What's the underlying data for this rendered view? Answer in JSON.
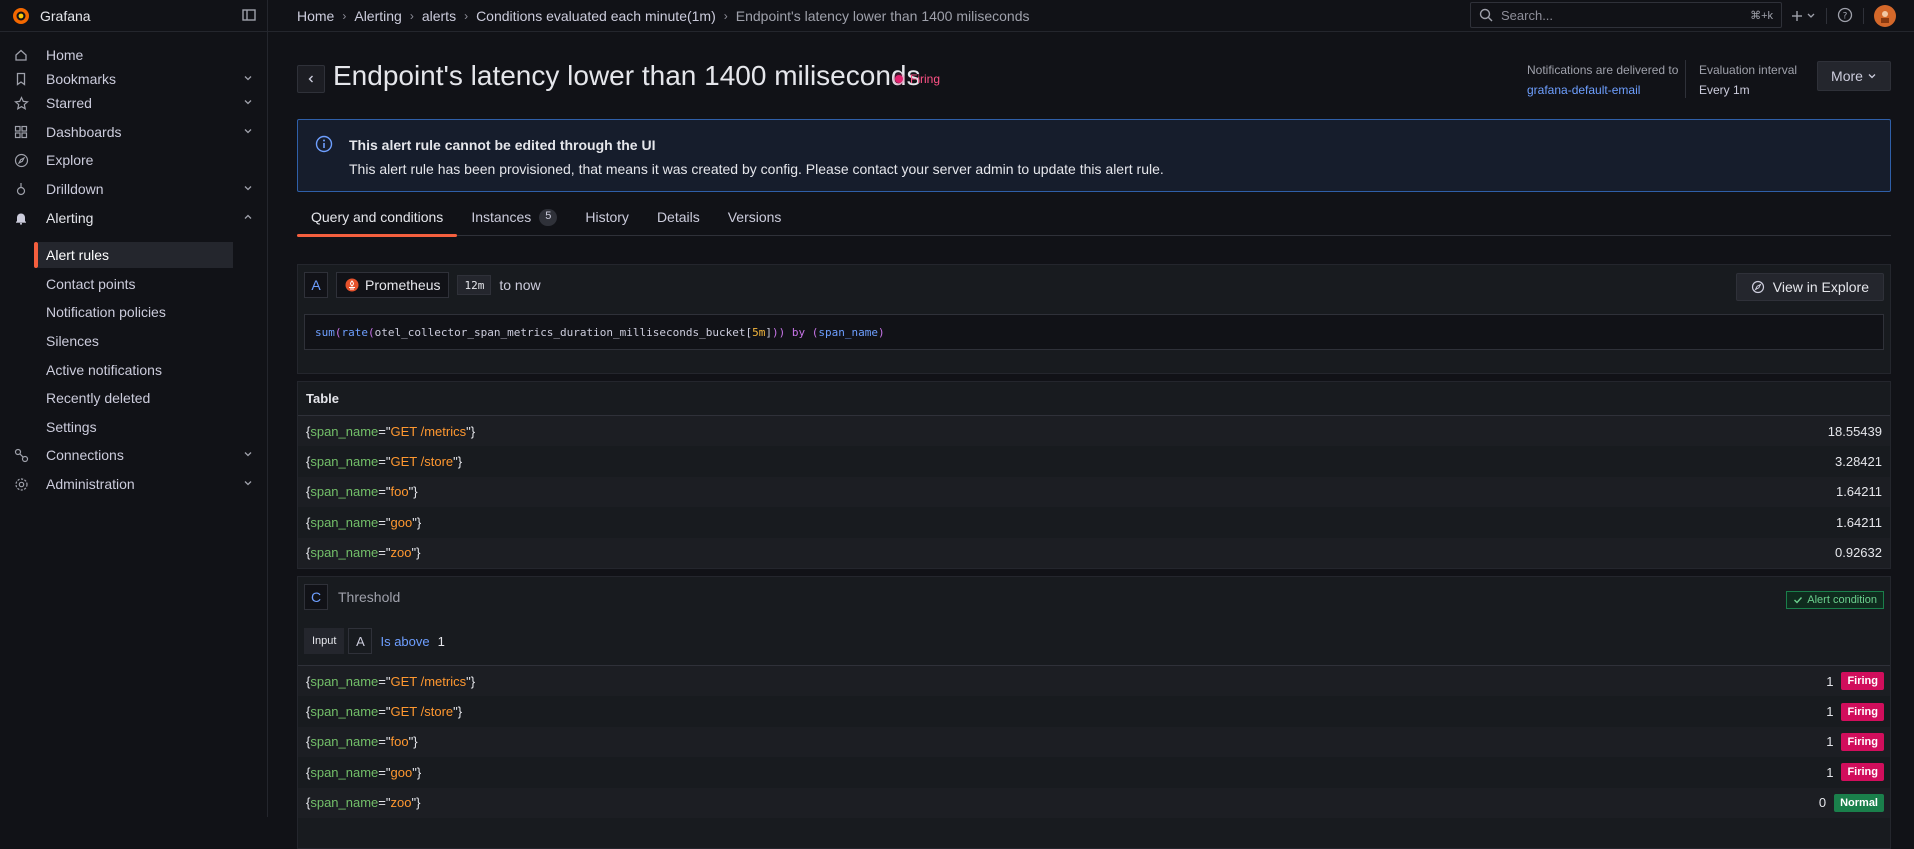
{
  "app": {
    "name": "Grafana"
  },
  "breadcrumbs": [
    "Home",
    "Alerting",
    "alerts",
    "Conditions evaluated each minute(1m)",
    "Endpoint's latency lower than 1400 miliseconds"
  ],
  "search": {
    "placeholder": "Search...",
    "shortcut": "⌘+k"
  },
  "sidebar": {
    "items": [
      {
        "label": "Home",
        "icon": "home-icon"
      },
      {
        "label": "Bookmarks",
        "icon": "bookmark-icon"
      },
      {
        "label": "Starred",
        "icon": "star-icon"
      },
      {
        "label": "Dashboards",
        "icon": "apps-icon"
      },
      {
        "label": "Explore",
        "icon": "compass-icon"
      },
      {
        "label": "Drilldown",
        "icon": "drilldown-icon"
      },
      {
        "label": "Alerting",
        "icon": "bell-icon"
      },
      {
        "label": "Connections",
        "icon": "link-icon"
      },
      {
        "label": "Administration",
        "icon": "cog-icon"
      }
    ],
    "alerting_sub": [
      "Alert rules",
      "Contact points",
      "Notification policies",
      "Silences",
      "Active notifications",
      "Recently deleted",
      "Settings"
    ]
  },
  "page": {
    "title": "Endpoint's latency lower than 1400 miliseconds",
    "state": "Firing",
    "notifications_label": "Notifications are delivered to",
    "notifications_target": "grafana-default-email",
    "eval_label": "Evaluation interval",
    "eval_value": "Every 1m",
    "more_label": "More"
  },
  "alert": {
    "heading": "This alert rule cannot be edited through the UI",
    "body": "This alert rule has been provisioned, that means it was created by config. Please contact your server admin to update this alert rule."
  },
  "tabs": [
    {
      "label": "Query and conditions"
    },
    {
      "label": "Instances",
      "count": "5"
    },
    {
      "label": "History"
    },
    {
      "label": "Details"
    },
    {
      "label": "Versions"
    }
  ],
  "query": {
    "ref": "A",
    "datasource": "Prometheus",
    "range": "12m",
    "range_suffix": "to now",
    "explore_label": "View in Explore",
    "expr": {
      "sum": "sum",
      "p1": "(",
      "rate": "rate",
      "p2": "(",
      "metric": "otel_collector_span_metrics_duration_milliseconds_bucket",
      "b1": "[",
      "dur": "5m",
      "b2": "]",
      "p3": "))",
      "by": "by",
      "p4": "(",
      "label": "span_name",
      "p5": ")"
    }
  },
  "table": {
    "header": "Table",
    "key": "span_name",
    "rows": [
      {
        "value": "GET /metrics",
        "number": "18.55439"
      },
      {
        "value": "GET /store",
        "number": "3.28421"
      },
      {
        "value": "foo",
        "number": "1.64211"
      },
      {
        "value": "goo",
        "number": "1.64211"
      },
      {
        "value": "zoo",
        "number": "0.92632"
      }
    ]
  },
  "condition": {
    "ref": "C",
    "type": "Threshold",
    "badge": "Alert condition",
    "input_label": "Input",
    "input_ref": "A",
    "operator": "Is above",
    "threshold": "1",
    "rows": [
      {
        "value": "GET /metrics",
        "result": "1",
        "state": "Firing"
      },
      {
        "value": "GET /store",
        "result": "1",
        "state": "Firing"
      },
      {
        "value": "foo",
        "result": "1",
        "state": "Firing"
      },
      {
        "value": "goo",
        "result": "1",
        "state": "Firing"
      },
      {
        "value": "zoo",
        "result": "0",
        "state": "Normal"
      }
    ]
  },
  "colors": {
    "accent": "#f55f3e",
    "firing": "#d10e5c",
    "normal": "#1a7f4b",
    "link": "#6e9fff"
  }
}
